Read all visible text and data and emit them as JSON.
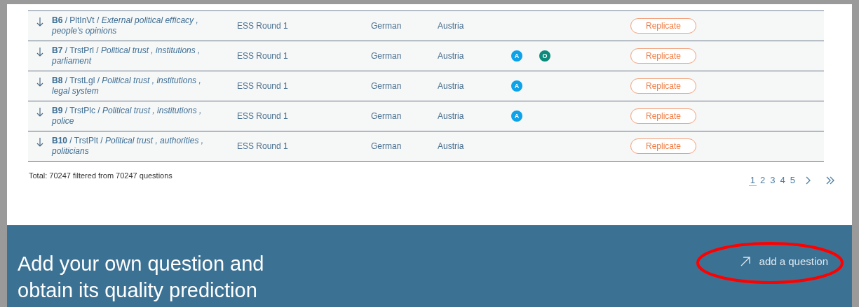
{
  "rows": [
    {
      "title": "**B6** / PltInVt / *External political efficacy , people's opinions*",
      "study": "ESS Round 1",
      "language": "German",
      "country": "Austria",
      "badges": [],
      "action": "Replicate"
    },
    {
      "title": "**B7** / TrstPrl / *Political trust , institutions , parliament*",
      "study": "ESS Round 1",
      "language": "German",
      "country": "Austria",
      "badges": [
        {
          "letter": "A",
          "color": "#0ea2e8"
        },
        {
          "letter": "O",
          "color": "#0e8a7c"
        }
      ],
      "action": "Replicate"
    },
    {
      "title": "**B8** / TrstLgl / *Political trust , institutions , legal system*",
      "study": "ESS Round 1",
      "language": "German",
      "country": "Austria",
      "badges": [
        {
          "letter": "A",
          "color": "#0ea2e8"
        }
      ],
      "action": "Replicate"
    },
    {
      "title": "**B9** / TrstPlc / *Political trust , institutions , police*",
      "study": "ESS Round 1",
      "language": "German",
      "country": "Austria",
      "badges": [
        {
          "letter": "A",
          "color": "#0ea2e8"
        }
      ],
      "action": "Replicate"
    },
    {
      "title": "**B10** / TrstPlt / *Political trust , authorities , politicians*",
      "study": "ESS Round 1",
      "language": "German",
      "country": "Austria",
      "badges": [],
      "action": "Replicate"
    }
  ],
  "total": "Total: 70247 filtered from 70247 questions",
  "pagination": {
    "pages": [
      {
        "label": "1",
        "selected": true
      },
      {
        "label": "2",
        "selected": false
      },
      {
        "label": "3",
        "selected": false
      },
      {
        "label": "4",
        "selected": false
      },
      {
        "label": "5",
        "selected": false
      }
    ],
    "next": true,
    "last": true
  },
  "footer": {
    "heading": "Add your own question and obtain its quality prediction",
    "link": "add a question",
    "circled": true
  }
}
